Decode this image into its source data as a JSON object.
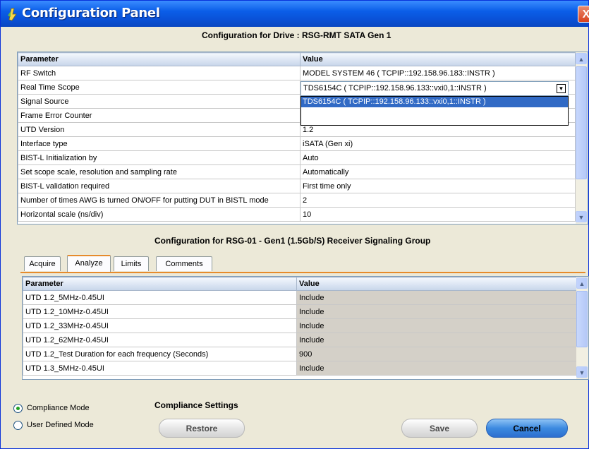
{
  "window": {
    "title": "Configuration Panel",
    "close_glyph": "X"
  },
  "top_section": {
    "title": "Configuration for Drive : RSG-RMT SATA Gen 1",
    "headers": {
      "parameter": "Parameter",
      "value": "Value"
    },
    "rows": [
      {
        "parameter": "RF Switch",
        "value": "MODEL SYSTEM 46 ( TCPIP::192.158.96.183::INSTR )"
      },
      {
        "parameter": "Real Time Scope",
        "value": "TDS6154C ( TCPIP::192.158.96.133::vxi0,1::INSTR )"
      },
      {
        "parameter": "Signal Source",
        "value": ""
      },
      {
        "parameter": "Frame Error Counter",
        "value": ""
      },
      {
        "parameter": "UTD Version",
        "value": "1.2"
      },
      {
        "parameter": "Interface type",
        "value": "iSATA (Gen xi)"
      },
      {
        "parameter": "BIST-L Initialization by",
        "value": "Auto"
      },
      {
        "parameter": "Set scope scale, resolution and sampling rate",
        "value": "Automatically"
      },
      {
        "parameter": "BIST-L validation required",
        "value": "First time only"
      },
      {
        "parameter": "Number of times AWG is turned ON/OFF for putting DUT in BISTL mode",
        "value": "2"
      },
      {
        "parameter": "Horizontal scale (ns/div)",
        "value": "10"
      }
    ],
    "dropdown_option": "TDS6154C ( TCPIP::192.158.96.133::vxi0,1::INSTR )"
  },
  "bottom_section": {
    "title": "Configuration for RSG-01 - Gen1 (1.5Gb/S) Receiver Signaling Group",
    "tabs": [
      {
        "label": "Acquire"
      },
      {
        "label": "Analyze"
      },
      {
        "label": "Limits"
      },
      {
        "label": "Comments"
      }
    ],
    "active_tab": "Analyze",
    "headers": {
      "parameter": "Parameter",
      "value": "Value"
    },
    "rows": [
      {
        "parameter": "UTD 1.2_5MHz-0.45UI",
        "value": "Include"
      },
      {
        "parameter": "UTD 1.2_10MHz-0.45UI",
        "value": "Include"
      },
      {
        "parameter": "UTD 1.2_33MHz-0.45UI",
        "value": "Include"
      },
      {
        "parameter": "UTD 1.2_62MHz-0.45UI",
        "value": "Include"
      },
      {
        "parameter": "UTD 1.2_Test Duration for each frequency (Seconds)",
        "value": "900"
      },
      {
        "parameter": "UTD 1.3_5MHz-0.45UI",
        "value": "Include"
      }
    ]
  },
  "footer": {
    "compliance_settings_label": "Compliance Settings",
    "modes": [
      {
        "label": "Compliance Mode",
        "selected": true
      },
      {
        "label": "User Defined Mode",
        "selected": false
      }
    ],
    "buttons": {
      "restore": "Restore",
      "save": "Save",
      "cancel": "Cancel"
    }
  },
  "colors": {
    "titlebar": "#0a52d8",
    "accent_tab": "#e68b2c",
    "selection": "#316ac5",
    "cancel_button": "#3c8ae0"
  }
}
